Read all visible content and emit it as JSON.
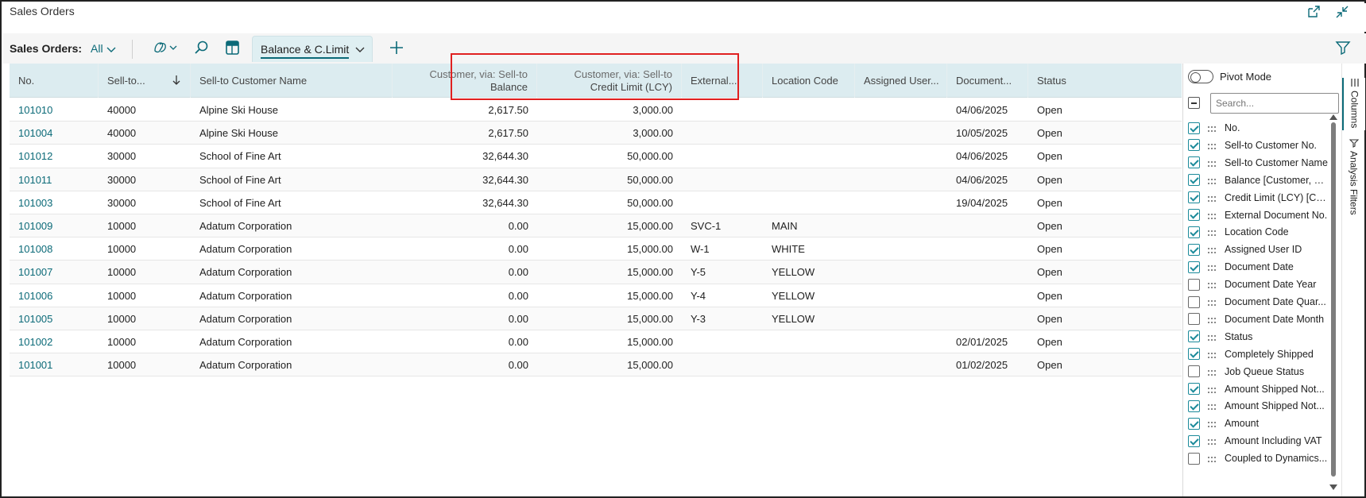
{
  "window": {
    "title": "Sales Orders"
  },
  "toolbar": {
    "page_label": "Sales Orders:",
    "filter_label": "All",
    "view_label": "Balance & C.Limit"
  },
  "columns": [
    {
      "key": "no",
      "label": "No."
    },
    {
      "key": "cust_no",
      "label": "Sell-to..."
    },
    {
      "key": "cust_name",
      "label": "Sell-to Customer Name"
    },
    {
      "key": "balance",
      "label_top": "Customer, via: Sell-to",
      "label_bottom": "Balance"
    },
    {
      "key": "credit",
      "label_top": "Customer, via: Sell-to",
      "label_bottom": "Credit Limit (LCY)"
    },
    {
      "key": "ext",
      "label": "External..."
    },
    {
      "key": "loc",
      "label": "Location Code"
    },
    {
      "key": "user",
      "label": "Assigned User..."
    },
    {
      "key": "date",
      "label": "Document..."
    },
    {
      "key": "status",
      "label": "Status"
    }
  ],
  "rows": [
    {
      "no": "101010",
      "cust_no": "40000",
      "cust_name": "Alpine Ski House",
      "balance": "2,617.50",
      "credit": "3,000.00",
      "ext": "",
      "loc": "",
      "user": "",
      "date": "04/06/2025",
      "status": "Open"
    },
    {
      "no": "101004",
      "cust_no": "40000",
      "cust_name": "Alpine Ski House",
      "balance": "2,617.50",
      "credit": "3,000.00",
      "ext": "",
      "loc": "",
      "user": "",
      "date": "10/05/2025",
      "status": "Open"
    },
    {
      "no": "101012",
      "cust_no": "30000",
      "cust_name": "School of Fine Art",
      "balance": "32,644.30",
      "credit": "50,000.00",
      "ext": "",
      "loc": "",
      "user": "",
      "date": "04/06/2025",
      "status": "Open"
    },
    {
      "no": "101011",
      "cust_no": "30000",
      "cust_name": "School of Fine Art",
      "balance": "32,644.30",
      "credit": "50,000.00",
      "ext": "",
      "loc": "",
      "user": "",
      "date": "04/06/2025",
      "status": "Open"
    },
    {
      "no": "101003",
      "cust_no": "30000",
      "cust_name": "School of Fine Art",
      "balance": "32,644.30",
      "credit": "50,000.00",
      "ext": "",
      "loc": "",
      "user": "",
      "date": "19/04/2025",
      "status": "Open"
    },
    {
      "no": "101009",
      "cust_no": "10000",
      "cust_name": "Adatum Corporation",
      "balance": "0.00",
      "credit": "15,000.00",
      "ext": "SVC-1",
      "loc": "MAIN",
      "user": "",
      "date": "",
      "status": "Open"
    },
    {
      "no": "101008",
      "cust_no": "10000",
      "cust_name": "Adatum Corporation",
      "balance": "0.00",
      "credit": "15,000.00",
      "ext": "W-1",
      "loc": "WHITE",
      "user": "",
      "date": "",
      "status": "Open"
    },
    {
      "no": "101007",
      "cust_no": "10000",
      "cust_name": "Adatum Corporation",
      "balance": "0.00",
      "credit": "15,000.00",
      "ext": "Y-5",
      "loc": "YELLOW",
      "user": "",
      "date": "",
      "status": "Open"
    },
    {
      "no": "101006",
      "cust_no": "10000",
      "cust_name": "Adatum Corporation",
      "balance": "0.00",
      "credit": "15,000.00",
      "ext": "Y-4",
      "loc": "YELLOW",
      "user": "",
      "date": "",
      "status": "Open"
    },
    {
      "no": "101005",
      "cust_no": "10000",
      "cust_name": "Adatum Corporation",
      "balance": "0.00",
      "credit": "15,000.00",
      "ext": "Y-3",
      "loc": "YELLOW",
      "user": "",
      "date": "",
      "status": "Open"
    },
    {
      "no": "101002",
      "cust_no": "10000",
      "cust_name": "Adatum Corporation",
      "balance": "0.00",
      "credit": "15,000.00",
      "ext": "",
      "loc": "",
      "user": "",
      "date": "02/01/2025",
      "status": "Open"
    },
    {
      "no": "101001",
      "cust_no": "10000",
      "cust_name": "Adatum Corporation",
      "balance": "0.00",
      "credit": "15,000.00",
      "ext": "",
      "loc": "",
      "user": "",
      "date": "01/02/2025",
      "status": "Open"
    }
  ],
  "panel": {
    "pivot_label": "Pivot Mode",
    "search_placeholder": "Search...",
    "columns": [
      {
        "label": "No.",
        "checked": true
      },
      {
        "label": "Sell-to Customer No.",
        "checked": true
      },
      {
        "label": "Sell-to Customer Name",
        "checked": true
      },
      {
        "label": "Balance [Customer, vi...",
        "checked": true
      },
      {
        "label": "Credit Limit (LCY) [Cu...",
        "checked": true
      },
      {
        "label": "External Document No.",
        "checked": true
      },
      {
        "label": "Location Code",
        "checked": true
      },
      {
        "label": "Assigned User ID",
        "checked": true
      },
      {
        "label": "Document Date",
        "checked": true
      },
      {
        "label": "Document Date Year",
        "checked": false
      },
      {
        "label": "Document Date Quar...",
        "checked": false
      },
      {
        "label": "Document Date Month",
        "checked": false
      },
      {
        "label": "Status",
        "checked": true
      },
      {
        "label": "Completely Shipped",
        "checked": true
      },
      {
        "label": "Job Queue Status",
        "checked": false
      },
      {
        "label": "Amount Shipped Not...",
        "checked": true
      },
      {
        "label": "Amount Shipped Not...",
        "checked": true
      },
      {
        "label": "Amount",
        "checked": true
      },
      {
        "label": "Amount Including VAT",
        "checked": true
      },
      {
        "label": "Coupled to Dynamics...",
        "checked": false
      }
    ]
  },
  "side_tabs": {
    "columns": "Columns",
    "filters": "Analysis Filters"
  },
  "colors": {
    "accent": "#0b6a78",
    "header_bg": "#dcecf0",
    "highlight": "#e02020"
  }
}
